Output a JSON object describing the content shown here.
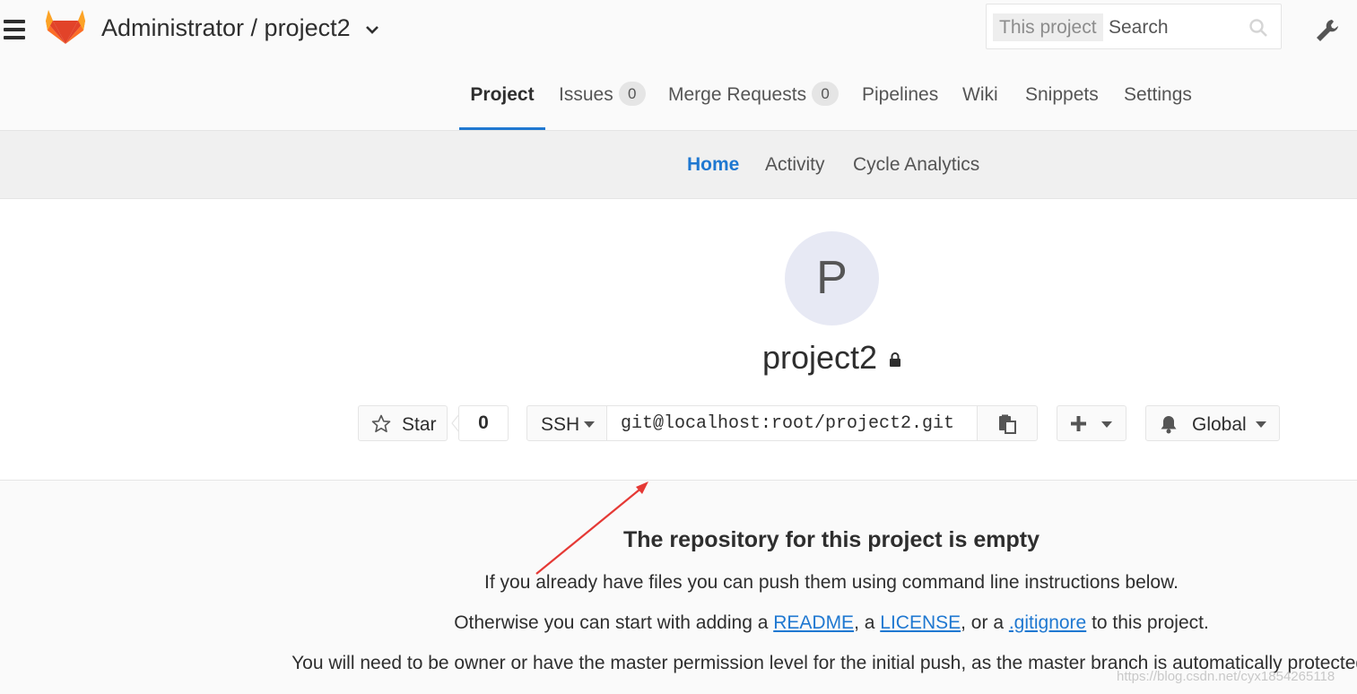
{
  "header": {
    "title": "Administrator / project2",
    "search": {
      "scope": "This project",
      "placeholder": "Search"
    }
  },
  "main_nav": [
    {
      "label": "Project",
      "active": true
    },
    {
      "label": "Issues",
      "count": "0"
    },
    {
      "label": "Merge Requests",
      "count": "0"
    },
    {
      "label": "Pipelines"
    },
    {
      "label": "Wiki"
    },
    {
      "label": "Snippets"
    },
    {
      "label": "Settings"
    }
  ],
  "sub_nav": [
    {
      "label": "Home",
      "active": true
    },
    {
      "label": "Activity"
    },
    {
      "label": "Cycle Analytics"
    }
  ],
  "project": {
    "avatar_letter": "P",
    "name": "project2",
    "star_label": "Star",
    "star_count": "0",
    "protocol": "SSH",
    "clone_url": "git@localhost:root/project2.git",
    "notification_level": "Global"
  },
  "empty_repo": {
    "title": "The repository for this project is empty",
    "line1": "If you already have files you can push them using command line instructions below.",
    "line2_prefix": "Otherwise you can start with adding a ",
    "readme": "README",
    "sep1": ", a ",
    "license": "LICENSE",
    "sep2": ", or a ",
    "gitignore": ".gitignore",
    "line2_suffix": " to this project.",
    "line3": "You will need to be owner or have the master permission level for the initial push, as the master branch is automatically protected."
  },
  "watermark": "https://blog.csdn.net/cyx1854265118",
  "colors": {
    "accent": "#1f78d1",
    "annotation_arrow": "#e53935",
    "avatar_bg": "#e7e9f4"
  }
}
